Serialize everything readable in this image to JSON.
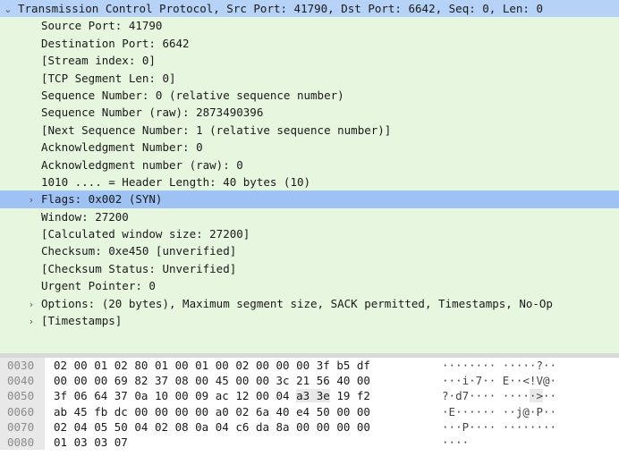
{
  "tree": {
    "rows": [
      {
        "text": "Transmission Control Protocol, Src Port: 41790, Dst Port: 6642, Seq: 0, Len: 0",
        "level": 0,
        "arrow": "expanded"
      },
      {
        "text": "Source Port: 41790",
        "level": 1
      },
      {
        "text": "Destination Port: 6642",
        "level": 1
      },
      {
        "text": "[Stream index: 0]",
        "level": 1
      },
      {
        "text": "[TCP Segment Len: 0]",
        "level": 1
      },
      {
        "text": "Sequence Number: 0    (relative sequence number)",
        "level": 1
      },
      {
        "text": "Sequence Number (raw): 2873490396",
        "level": 1
      },
      {
        "text": "[Next Sequence Number: 1    (relative sequence number)]",
        "level": 1
      },
      {
        "text": "Acknowledgment Number: 0",
        "level": 1
      },
      {
        "text": "Acknowledgment number (raw): 0",
        "level": 1
      },
      {
        "text": "1010 .... = Header Length: 40 bytes (10)",
        "level": 1
      },
      {
        "text": "Flags: 0x002 (SYN)",
        "level": 1,
        "arrow": "collapsed",
        "selected": true
      },
      {
        "text": "Window: 27200",
        "level": 1
      },
      {
        "text": "[Calculated window size: 27200]",
        "level": 1
      },
      {
        "text": "Checksum: 0xe450 [unverified]",
        "level": 1
      },
      {
        "text": "[Checksum Status: Unverified]",
        "level": 1
      },
      {
        "text": "Urgent Pointer: 0",
        "level": 1
      },
      {
        "text": "Options: (20 bytes), Maximum segment size, SACK permitted, Timestamps, No-Op",
        "level": 1,
        "arrow": "collapsed"
      },
      {
        "text": "[Timestamps]",
        "level": 1,
        "arrow": "collapsed"
      }
    ]
  },
  "hex": {
    "rows": [
      {
        "offset": "0030",
        "bytes1": "02 00 01 02 80 01 00 01",
        "bytes2": "00 02 00 00 00 3f b5 df",
        "ascii1": "········",
        "ascii2": "·····?··"
      },
      {
        "offset": "0040",
        "bytes1": "00 00 00 69 82 37 08 00",
        "bytes2": "45 00 00 3c 21 56 40 00",
        "ascii1": "···i·7··",
        "ascii2": "E··<!V@·"
      },
      {
        "offset": "0050",
        "bytes1": "3f 06 64 37 0a 10 00 09",
        "bytes2": "ac 12 00 04 a3 3e 19 f2",
        "ascii1": "?·d7····",
        "ascii2": "·····>··",
        "hl_bytes2": [
          4,
          5
        ],
        "hl_ascii2": [
          4,
          5
        ]
      },
      {
        "offset": "0060",
        "bytes1": "ab 45 fb dc 00 00 00 00",
        "bytes2": "a0 02 6a 40 e4 50 00 00",
        "ascii1": "·E······",
        "ascii2": "··j@·P··"
      },
      {
        "offset": "0070",
        "bytes1": "02 04 05 50 04 02 08 0a",
        "bytes2": "04 c6 da 8a 00 00 00 00",
        "ascii1": "···P····",
        "ascii2": "········"
      },
      {
        "offset": "0080",
        "bytes1": "01 03 03 07",
        "bytes2": "",
        "ascii1": "····",
        "ascii2": ""
      }
    ]
  }
}
